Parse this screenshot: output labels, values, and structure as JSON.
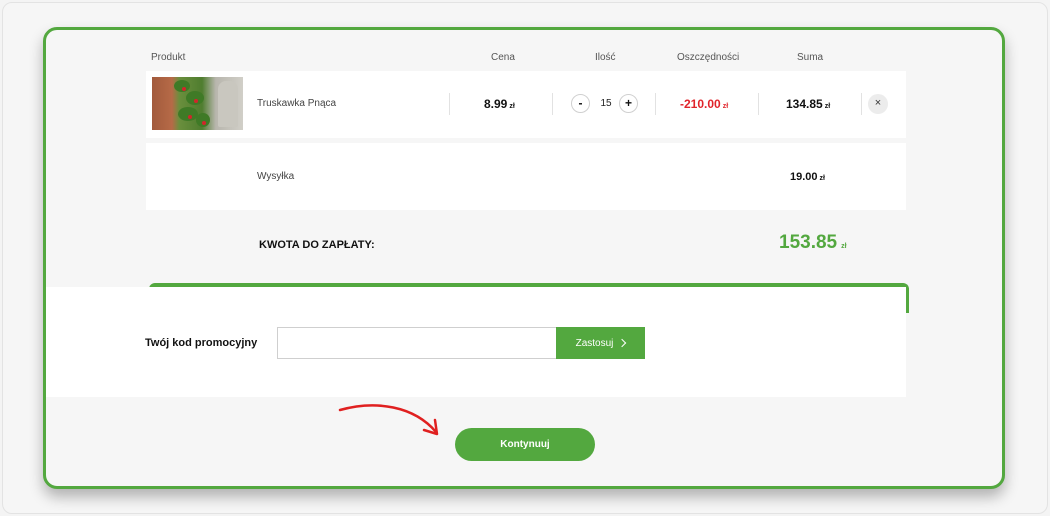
{
  "header": {
    "product": "Produkt",
    "price": "Cena",
    "quantity": "Ilość",
    "savings": "Oszczędności",
    "sum": "Suma"
  },
  "item": {
    "name": "Truskawka Pnąca",
    "price": "8.99",
    "quantity": "15",
    "savings": "-210.00",
    "total": "134.85",
    "currency": "zł",
    "decrement_label": "-",
    "increment_label": "+",
    "remove_label": "×"
  },
  "shipping": {
    "label": "Wysyłka",
    "price": "19.00"
  },
  "summary": {
    "label": "KWOTA DO ZAPŁATY:",
    "total": "153.85"
  },
  "promo": {
    "label": "Twój kod promocyjny",
    "value": "",
    "button_label": "Zastosuj"
  },
  "actions": {
    "continue_label": "Kontynuuj"
  },
  "colors": {
    "accent": "#53a83f",
    "savings": "#e0242b",
    "annotation_arrow": "#e02020"
  },
  "icons": {
    "apply": "chevron-right-icon",
    "remove": "close-icon",
    "annotation": "curved-arrow-icon"
  }
}
